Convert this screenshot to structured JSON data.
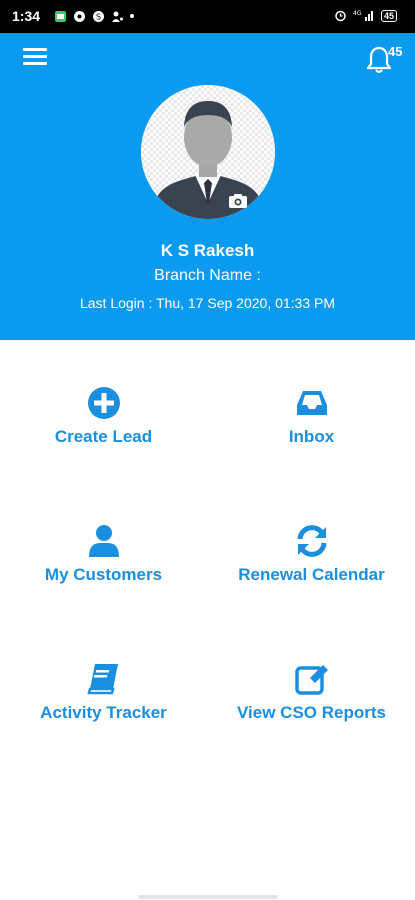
{
  "status_bar": {
    "time": "1:34",
    "battery": "45"
  },
  "header": {
    "notification_count": "45",
    "user_name": "K S Rakesh",
    "branch_label": "Branch Name :",
    "last_login": "Last Login : Thu, 17 Sep 2020, 01:33 PM"
  },
  "menu": {
    "items": [
      {
        "label": "Create Lead",
        "icon": "plus-circle-icon"
      },
      {
        "label": "Inbox",
        "icon": "inbox-tray-icon"
      },
      {
        "label": "My Customers",
        "icon": "user-icon"
      },
      {
        "label": "Renewal Calendar",
        "icon": "refresh-icon"
      },
      {
        "label": "Activity Tracker",
        "icon": "book-icon"
      },
      {
        "label": "View CSO Reports",
        "icon": "edit-icon"
      }
    ]
  },
  "colors": {
    "primary": "#0a9af0",
    "accent_text": "#1a8fdf",
    "status_bar": "#000000"
  }
}
